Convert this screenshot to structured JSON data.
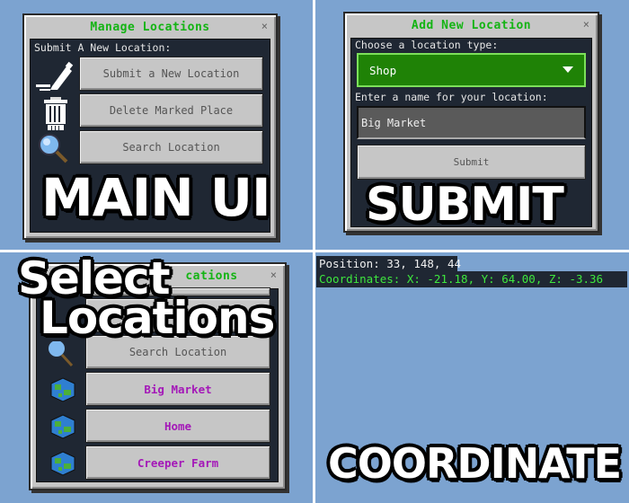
{
  "main_ui": {
    "title": "Manage Locations",
    "close": "×",
    "label": "Submit A New Location:",
    "buttons": [
      "Submit a New Location",
      "Delete Marked Place",
      "Search Location"
    ],
    "icons": [
      "pencil-icon",
      "trash-icon",
      "magnifier-icon"
    ],
    "caption": "MAIN UI"
  },
  "submit": {
    "title": "Add New Location",
    "close": "×",
    "type_label": "Choose a location type:",
    "type_value": "Shop",
    "name_label": "Enter a name for your location:",
    "name_value": "Big Market",
    "submit_label": "Submit",
    "caption": "SUBMIT"
  },
  "select": {
    "title_visible": "cations",
    "close": "×",
    "search_label": "Search Location",
    "locations": [
      "Big Market",
      "Home",
      "Creeper Farm"
    ],
    "caption_line1": "Select",
    "caption_line2": "Locations"
  },
  "coordinate": {
    "position": "Position: 33, 148, 44",
    "coordinates": "Coordinates: X: -21.18, Y: 64.00, Z: -3.36",
    "caption": "COORDINATE"
  },
  "colors": {
    "background": "#7ca3d0",
    "title_green": "#14b414",
    "dropdown_green": "#1f8206",
    "location_purple": "#a418b8",
    "hud_green": "#3ee83e"
  }
}
